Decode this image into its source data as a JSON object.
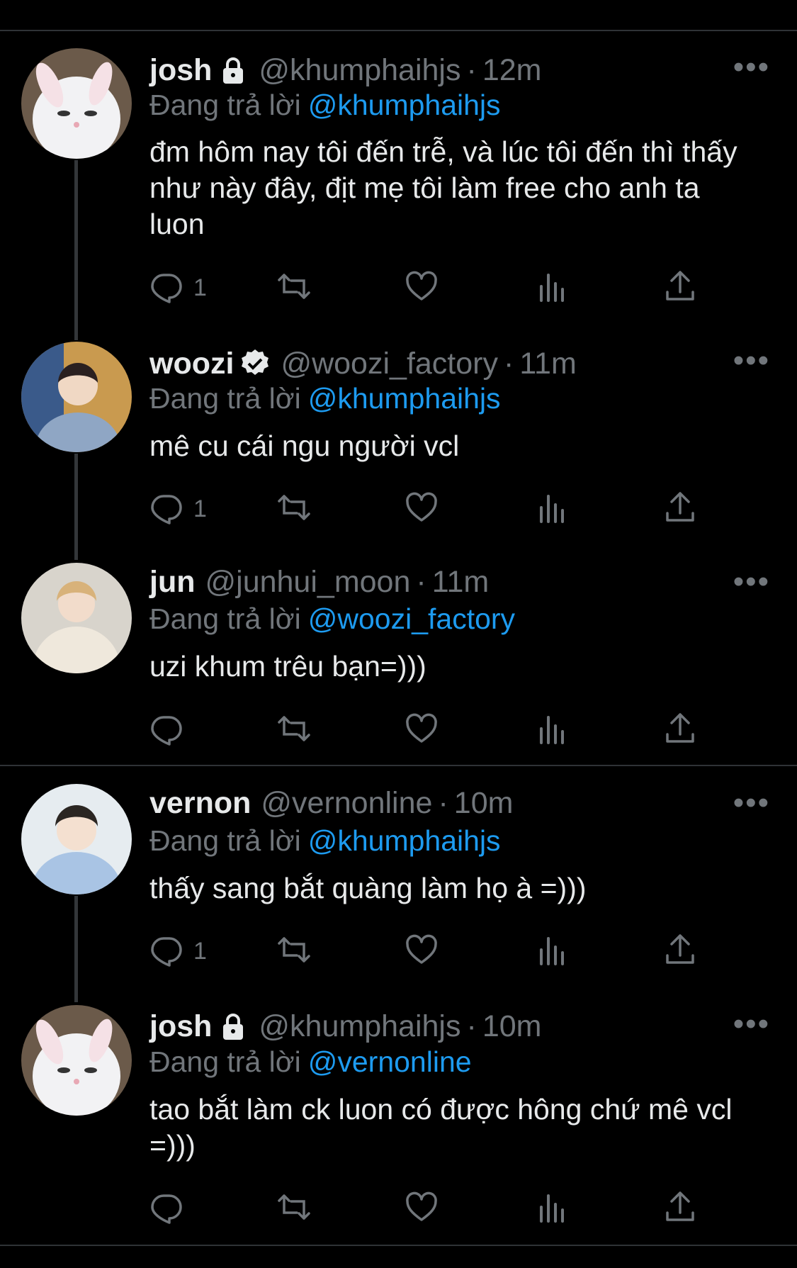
{
  "tweets": [
    {
      "name": "josh",
      "badge": "lock",
      "handle": "@khumphaihjs",
      "time": "12m",
      "reply_label": "Đang trả lời",
      "reply_to": "@khumphaihjs",
      "text": "đm hôm nay tôi đến trễ, và lúc tôi đến thì thấy như này đây, địt mẹ tôi làm free cho anh ta luon",
      "reply_count": "1"
    },
    {
      "name": "woozi",
      "badge": "verified",
      "handle": "@woozi_factory",
      "time": "11m",
      "reply_label": "Đang trả lời",
      "reply_to": "@khumphaihjs",
      "text": "mê cu cái ngu người vcl",
      "reply_count": "1"
    },
    {
      "name": "jun",
      "badge": "",
      "handle": "@junhui_moon",
      "time": "11m",
      "reply_label": "Đang trả lời",
      "reply_to": "@woozi_factory",
      "text": "uzi khum trêu bạn=)))",
      "reply_count": ""
    },
    {
      "name": "vernon",
      "badge": "",
      "handle": "@vernonline",
      "time": "10m",
      "reply_label": "Đang trả lời",
      "reply_to": "@khumphaihjs",
      "text": "thấy sang bắt quàng làm họ à =)))",
      "reply_count": "1"
    },
    {
      "name": "josh",
      "badge": "lock",
      "handle": "@khumphaihjs",
      "time": "10m",
      "reply_label": "Đang trả lời",
      "reply_to": "@vernonline",
      "text": "tao bắt làm ck luon có được hông chứ mê vcl =)))",
      "reply_count": ""
    }
  ],
  "more_label": "•••",
  "dot": "·",
  "icons": [
    "reply-icon",
    "retweet-icon",
    "like-icon",
    "views-icon",
    "share-icon"
  ],
  "colors": {
    "background": "#000000",
    "text": "#e7e9ea",
    "muted": "#71767b",
    "mention": "#1d9bf0",
    "separator": "#2f3336"
  }
}
